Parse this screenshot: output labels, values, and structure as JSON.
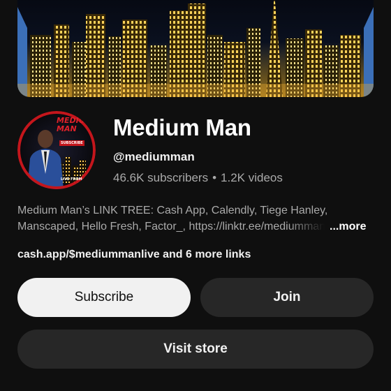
{
  "channel": {
    "name": "Medium Man",
    "handle": "@mediumman",
    "subscribers": "46.6K subscribers",
    "separator": "•",
    "videos": "1.2K videos"
  },
  "description": {
    "line1": "Medium Man’s LINK TREE: Cash App, Calendly, Tiege Hanley,",
    "line2": "Manscaped, Hello Fresh, Factor_, https://linktr.ee/mediumman",
    "more_label": "...more"
  },
  "links": {
    "text": "cash.app/$mediummanlive and 6 more links"
  },
  "buttons": {
    "subscribe_label": "Subscribe",
    "join_label": "Join",
    "visit_store_label": "Visit store"
  },
  "avatar": {
    "title_text": "MEDIUM MAN",
    "subscribe_badge": "SUBSCRIBE",
    "footer_text": "LIVE FROM"
  },
  "colors": {
    "background": "#0f0f0f",
    "subscribe_bg": "#f1f1f1",
    "secondary_button_bg": "#272727",
    "muted_text": "#aaaaaa",
    "avatar_border": "#c4161c"
  }
}
